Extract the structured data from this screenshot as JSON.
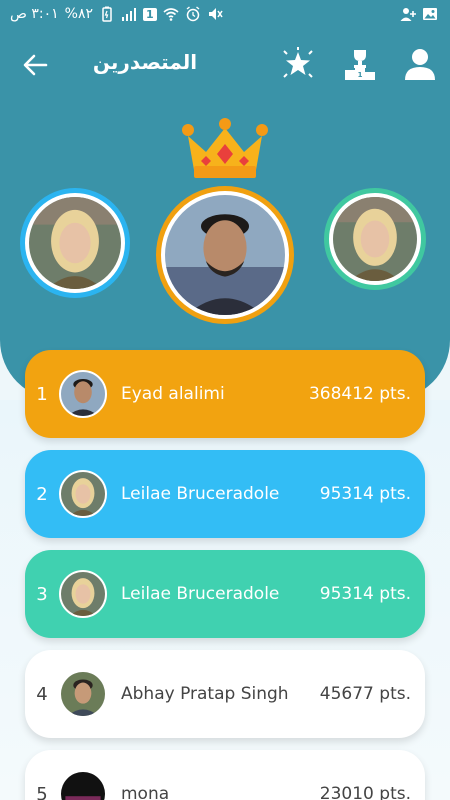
{
  "status_bar": {
    "time": "٣:٠١ ص",
    "battery": "%٨٢",
    "sim": "1"
  },
  "app_bar": {
    "title": "المتصدرين"
  },
  "colors": {
    "header": "#3a93a8",
    "gold": "#f2a310",
    "blue": "#33bdf5",
    "green": "#40d1b0",
    "white": "#ffffff"
  },
  "leaderboard": [
    {
      "rank": "1",
      "name": "Eyad alalimi",
      "points": "368412 pts."
    },
    {
      "rank": "2",
      "name": "Leilae Bruceradole",
      "points": "95314 pts."
    },
    {
      "rank": "3",
      "name": "Leilae Bruceradole",
      "points": "95314 pts."
    },
    {
      "rank": "4",
      "name": "Abhay Pratap Singh",
      "points": "45677 pts."
    },
    {
      "rank": "5",
      "name": "mona",
      "points": "23010 pts."
    }
  ]
}
